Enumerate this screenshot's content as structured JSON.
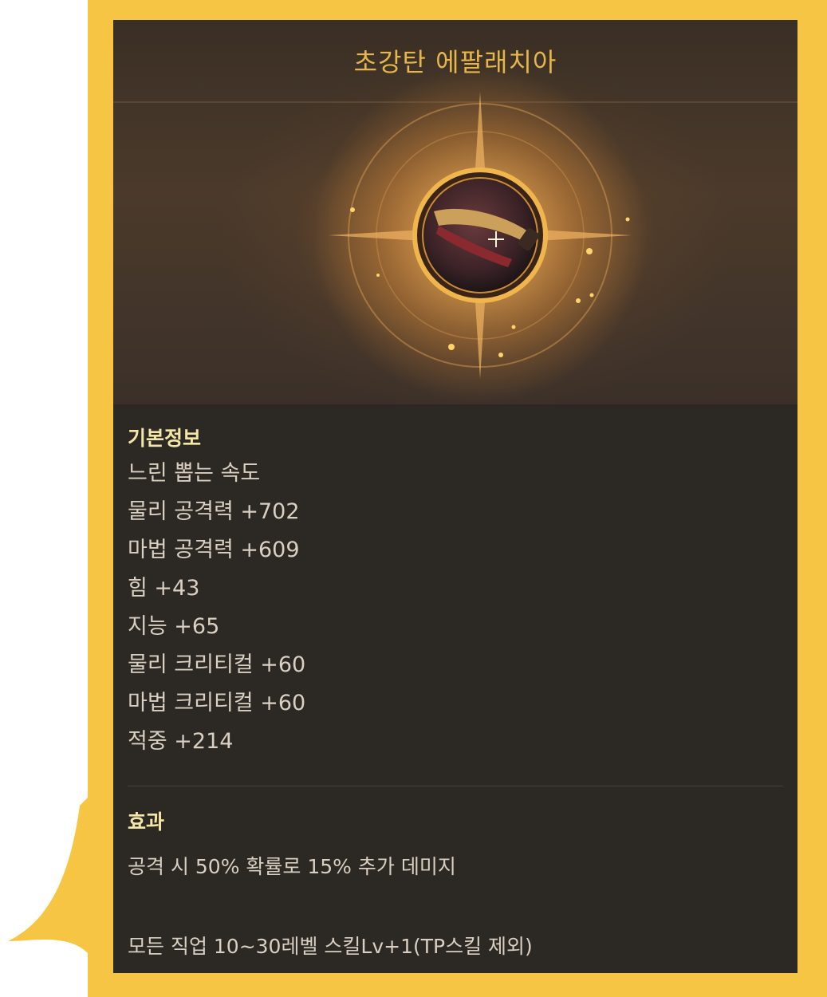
{
  "item": {
    "name": "초강탄 에팔래치아",
    "icon": "weapon-icon"
  },
  "basic_info": {
    "title": "기본정보",
    "stats": [
      "느린 뽑는 속도",
      "물리 공격력 +702",
      "마법 공격력 +609",
      "힘 +43",
      "지능 +65",
      "물리 크리티컬 +60",
      "마법 크리티컬 +60",
      "적중 +214"
    ]
  },
  "effects": {
    "title": "효과",
    "lines": [
      "공격 시 50% 확률로 15% 추가 데미지",
      "모든 직업 10~30레벨 스킬Lv+1(TP스킬 제외)"
    ]
  },
  "colors": {
    "frame": "#f7c544",
    "panel_bg": "#2c2823",
    "title_gold": "#e6b64a",
    "section_title": "#f3e6a6",
    "text": "#d9cfc2"
  }
}
